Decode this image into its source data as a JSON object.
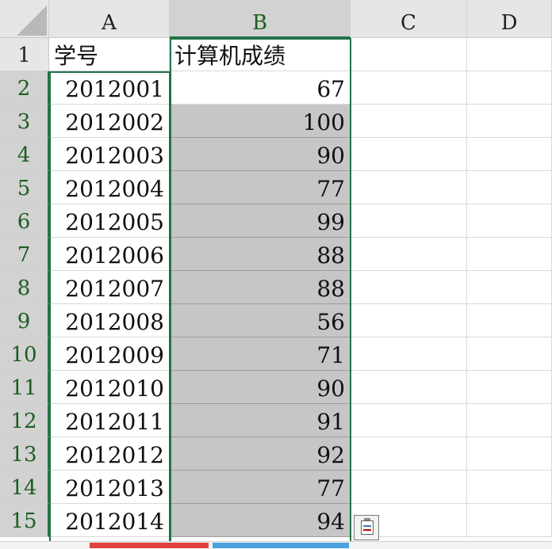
{
  "columns": [
    "A",
    "B",
    "C",
    "D"
  ],
  "rows": [
    "1",
    "2",
    "3",
    "4",
    "5",
    "6",
    "7",
    "8",
    "9",
    "10",
    "11",
    "12",
    "13",
    "14",
    "15"
  ],
  "header_row": {
    "a": "学号",
    "b": "计算机成绩"
  },
  "data": [
    {
      "a": "2012001",
      "b": "67"
    },
    {
      "a": "2012002",
      "b": "100"
    },
    {
      "a": "2012003",
      "b": "90"
    },
    {
      "a": "2012004",
      "b": "77"
    },
    {
      "a": "2012005",
      "b": "99"
    },
    {
      "a": "2012006",
      "b": "88"
    },
    {
      "a": "2012007",
      "b": "88"
    },
    {
      "a": "2012008",
      "b": "56"
    },
    {
      "a": "2012009",
      "b": "71"
    },
    {
      "a": "2012010",
      "b": "90"
    },
    {
      "a": "2012011",
      "b": "91"
    },
    {
      "a": "2012012",
      "b": "92"
    },
    {
      "a": "2012013",
      "b": "77"
    },
    {
      "a": "2012014",
      "b": "94"
    }
  ],
  "colors": {
    "selection": "#217346",
    "highlight_fill": "#c6c6c6",
    "header_bg": "#e6e6e6"
  },
  "icons": {
    "paste_options": "paste-options-icon"
  }
}
